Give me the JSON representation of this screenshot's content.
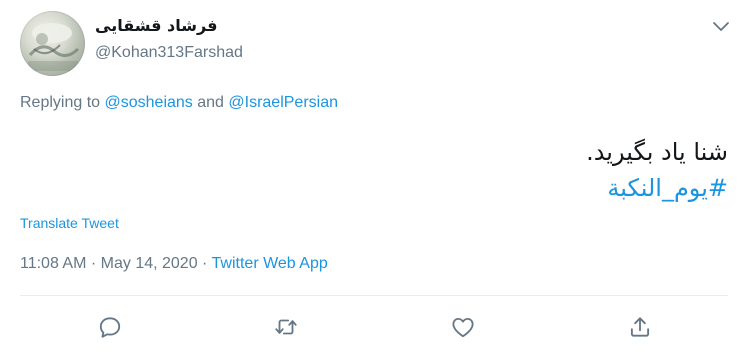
{
  "author": {
    "display_name": "فرشاد قشقایی",
    "handle": "@Kohan313Farshad"
  },
  "reply_context": {
    "prefix": "Replying to ",
    "mention_1": "@sosheians",
    "conjunction": " and ",
    "mention_2": "@IsraelPersian"
  },
  "tweet": {
    "text": "شنا یاد بگیرید.",
    "hashtag": "#یوم_النکبة"
  },
  "translate_label": "Translate Tweet",
  "meta": {
    "time": "11:08 AM",
    "separator_1": " · ",
    "date": "May 14, 2020",
    "separator_2": " · ",
    "app": "Twitter Web App"
  },
  "actions": {
    "reply_icon": "reply-icon",
    "retweet_icon": "retweet-icon",
    "like_icon": "heart-icon",
    "share_icon": "share-icon"
  },
  "colors": {
    "link": "#1b95e0",
    "secondary_text": "#657786",
    "primary_text": "#14171a",
    "divider": "#e6ecf0"
  }
}
